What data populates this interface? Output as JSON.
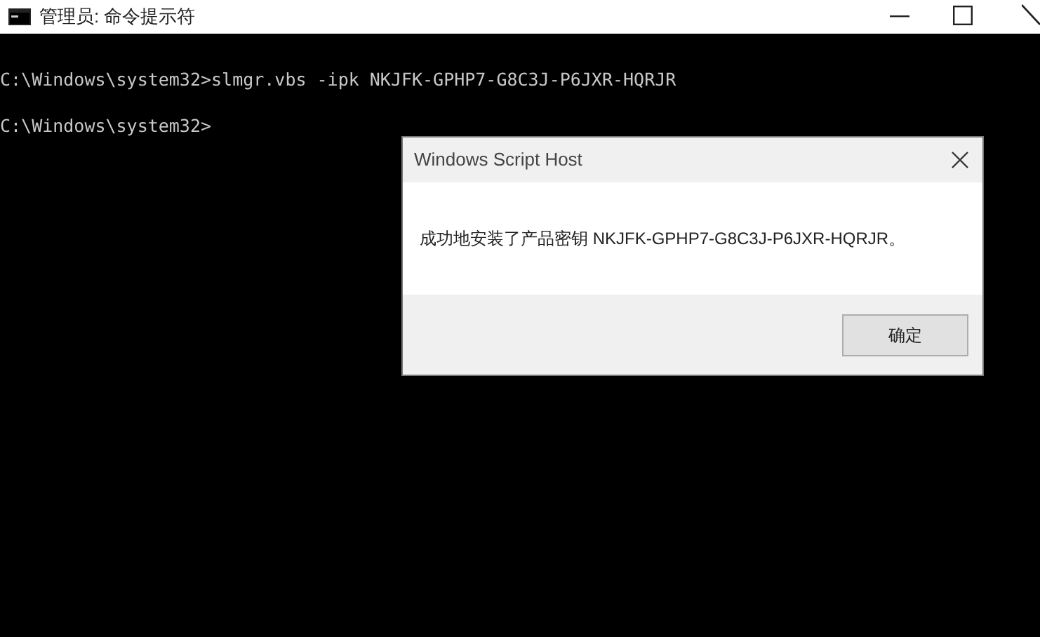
{
  "window": {
    "title": "管理员: 命令提示符"
  },
  "console": {
    "lines": [
      "C:\\Windows\\system32>slmgr.vbs -ipk NKJFK-GPHP7-G8C3J-P6JXR-HQRJR",
      "C:\\Windows\\system32>"
    ]
  },
  "dialog": {
    "title": "Windows Script Host",
    "message": "成功地安装了产品密钥 NKJFK-GPHP7-G8C3J-P6JXR-HQRJR。",
    "buttons": [
      "确定"
    ]
  }
}
